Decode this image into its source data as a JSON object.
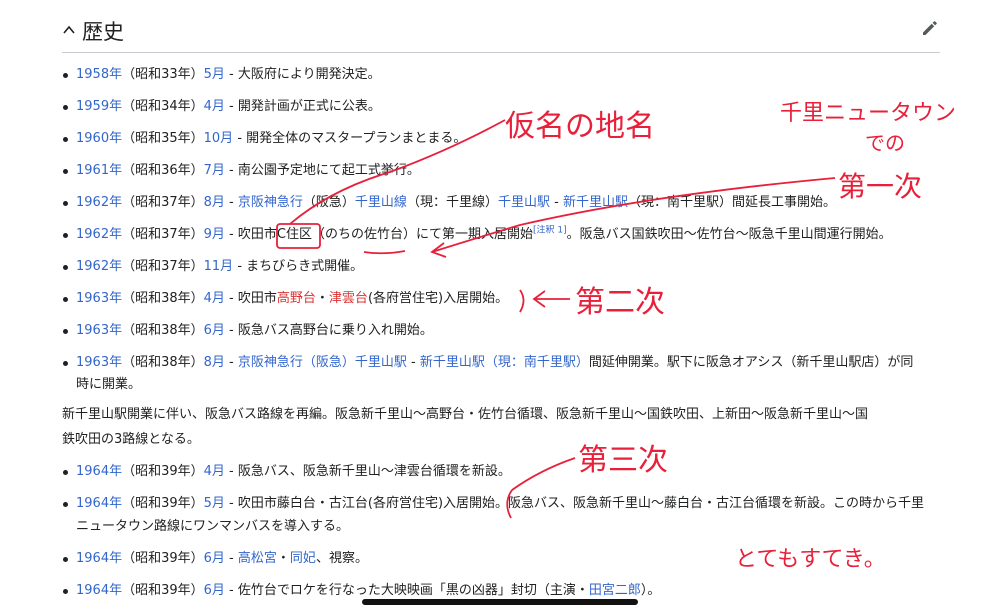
{
  "section": {
    "title": "歴史"
  },
  "items": [
    {
      "seg": [
        {
          "t": "1958年",
          "c": "lk"
        },
        {
          "t": "（昭和33年）"
        },
        {
          "t": "5月",
          "c": "lk"
        },
        {
          "t": " - 大阪府により開発決定。"
        }
      ]
    },
    {
      "seg": [
        {
          "t": "1959年",
          "c": "lk"
        },
        {
          "t": "（昭和34年）"
        },
        {
          "t": "4月",
          "c": "lk"
        },
        {
          "t": " - 開発計画が正式に公表。"
        }
      ]
    },
    {
      "seg": [
        {
          "t": "1960年",
          "c": "lk"
        },
        {
          "t": "（昭和35年）"
        },
        {
          "t": "10月",
          "c": "lk"
        },
        {
          "t": " - 開発全体のマスタープランまとまる。"
        }
      ]
    },
    {
      "seg": [
        {
          "t": "1961年",
          "c": "lk"
        },
        {
          "t": "（昭和36年）"
        },
        {
          "t": "7月",
          "c": "lk"
        },
        {
          "t": " - 南公園予定地にて起工式挙行。"
        }
      ]
    },
    {
      "seg": [
        {
          "t": "1962年",
          "c": "lk"
        },
        {
          "t": "（昭和37年）"
        },
        {
          "t": "8月",
          "c": "lk"
        },
        {
          "t": " - "
        },
        {
          "t": "京阪神急行",
          "c": "lk"
        },
        {
          "t": "（阪急）"
        },
        {
          "t": "千里山線",
          "c": "lk"
        },
        {
          "t": "（現：千里線）"
        },
        {
          "t": "千里山駅",
          "c": "lk"
        },
        {
          "t": " - "
        },
        {
          "t": "新千里山駅",
          "c": "lk"
        },
        {
          "t": "（現：南千里駅）間延長工事開始。"
        }
      ]
    },
    {
      "seg": [
        {
          "t": "1962年",
          "c": "lk"
        },
        {
          "t": "（昭和37年）"
        },
        {
          "t": "9月",
          "c": "lk"
        },
        {
          "t": " - 吹田市C住区（のちの佐竹台）にて第一期入居開始"
        },
        {
          "t": "[注釈 1]",
          "c": "sup"
        },
        {
          "t": "。阪急バス国鉄吹田〜佐竹台〜阪急千里山間運行開始。"
        }
      ]
    },
    {
      "seg": [
        {
          "t": "1962年",
          "c": "lk"
        },
        {
          "t": "（昭和37年）"
        },
        {
          "t": "11月",
          "c": "lk"
        },
        {
          "t": " - まちびらき式開催。"
        }
      ]
    },
    {
      "seg": [
        {
          "t": "1963年",
          "c": "lk"
        },
        {
          "t": "（昭和38年）"
        },
        {
          "t": "4月",
          "c": "lk"
        },
        {
          "t": " - 吹田市"
        },
        {
          "t": "高野台",
          "c": "rd"
        },
        {
          "t": "・"
        },
        {
          "t": "津雲台",
          "c": "rd"
        },
        {
          "t": "(各府営住宅)入居開始。"
        }
      ]
    },
    {
      "seg": [
        {
          "t": "1963年",
          "c": "lk"
        },
        {
          "t": "（昭和38年）"
        },
        {
          "t": "6月",
          "c": "lk"
        },
        {
          "t": " - 阪急バス高野台に乗り入れ開始。"
        }
      ]
    },
    {
      "seg": [
        {
          "t": "1963年",
          "c": "lk"
        },
        {
          "t": "（昭和38年）"
        },
        {
          "t": "8月",
          "c": "lk"
        },
        {
          "t": " - "
        },
        {
          "t": "京阪神急行（阪急）千里山駅",
          "c": "lk"
        },
        {
          "t": " - "
        },
        {
          "t": "新千里山駅（現：南千里駅）",
          "c": "lk"
        },
        {
          "t": "間延伸開業。駅下に阪急オアシス（新千里山駅店）が同"
        }
      ]
    },
    {
      "cont": true,
      "seg": [
        {
          "t": "時に開業。"
        }
      ]
    },
    {
      "para": true,
      "seg": [
        {
          "t": "新千里山駅開業に伴い、阪急バス路線を再編。阪急新千里山〜高野台・佐竹台循環、阪急新千里山〜国鉄吹田、上新田〜阪急新千里山〜国"
        }
      ]
    },
    {
      "para": true,
      "seg": [
        {
          "t": "鉄吹田の3路線となる。"
        }
      ]
    },
    {
      "seg": [
        {
          "t": "1964年",
          "c": "lk"
        },
        {
          "t": "（昭和39年）"
        },
        {
          "t": "4月",
          "c": "lk"
        },
        {
          "t": " - 阪急バス、阪急新千里山〜津雲台循環を新設。"
        }
      ]
    },
    {
      "seg": [
        {
          "t": "1964年",
          "c": "lk"
        },
        {
          "t": "（昭和39年）"
        },
        {
          "t": "5月",
          "c": "lk"
        },
        {
          "t": " - 吹田市藤白台・古江台(各府営住宅)入居開始。阪急バス、阪急新千里山〜藤白台・古江台循環を新設。この時から千里"
        }
      ]
    },
    {
      "cont": true,
      "seg": [
        {
          "t": "ニュータウン路線にワンマンバスを導入する。"
        }
      ]
    },
    {
      "seg": [
        {
          "t": "1964年",
          "c": "lk"
        },
        {
          "t": "（昭和39年）"
        },
        {
          "t": "6月",
          "c": "lk"
        },
        {
          "t": " - "
        },
        {
          "t": "高松宮",
          "c": "lk"
        },
        {
          "t": "・"
        },
        {
          "t": "同妃",
          "c": "lk"
        },
        {
          "t": "、視察。"
        }
      ]
    },
    {
      "seg": [
        {
          "t": "1964年",
          "c": "lk"
        },
        {
          "t": "（昭和39年）"
        },
        {
          "t": "6月",
          "c": "lk"
        },
        {
          "t": " - 佐竹台でロケを行なった大映映画「黒の凶器」封切（主演・"
        },
        {
          "t": "田宮二郎",
          "c": "lk"
        },
        {
          "t": "）。"
        }
      ]
    }
  ],
  "annotations": {
    "kana_chimei": "仮名の地名",
    "senri_nt_1": "千里ニュータウン",
    "senri_nt_2": "での",
    "dai1": "第一次",
    "dai2": "第二次",
    "dai3": "第三次",
    "totemo": "とてもすてき。"
  },
  "colors": {
    "link": "#3366cc",
    "redlink": "#dd3333",
    "ink": "#e8203a"
  }
}
